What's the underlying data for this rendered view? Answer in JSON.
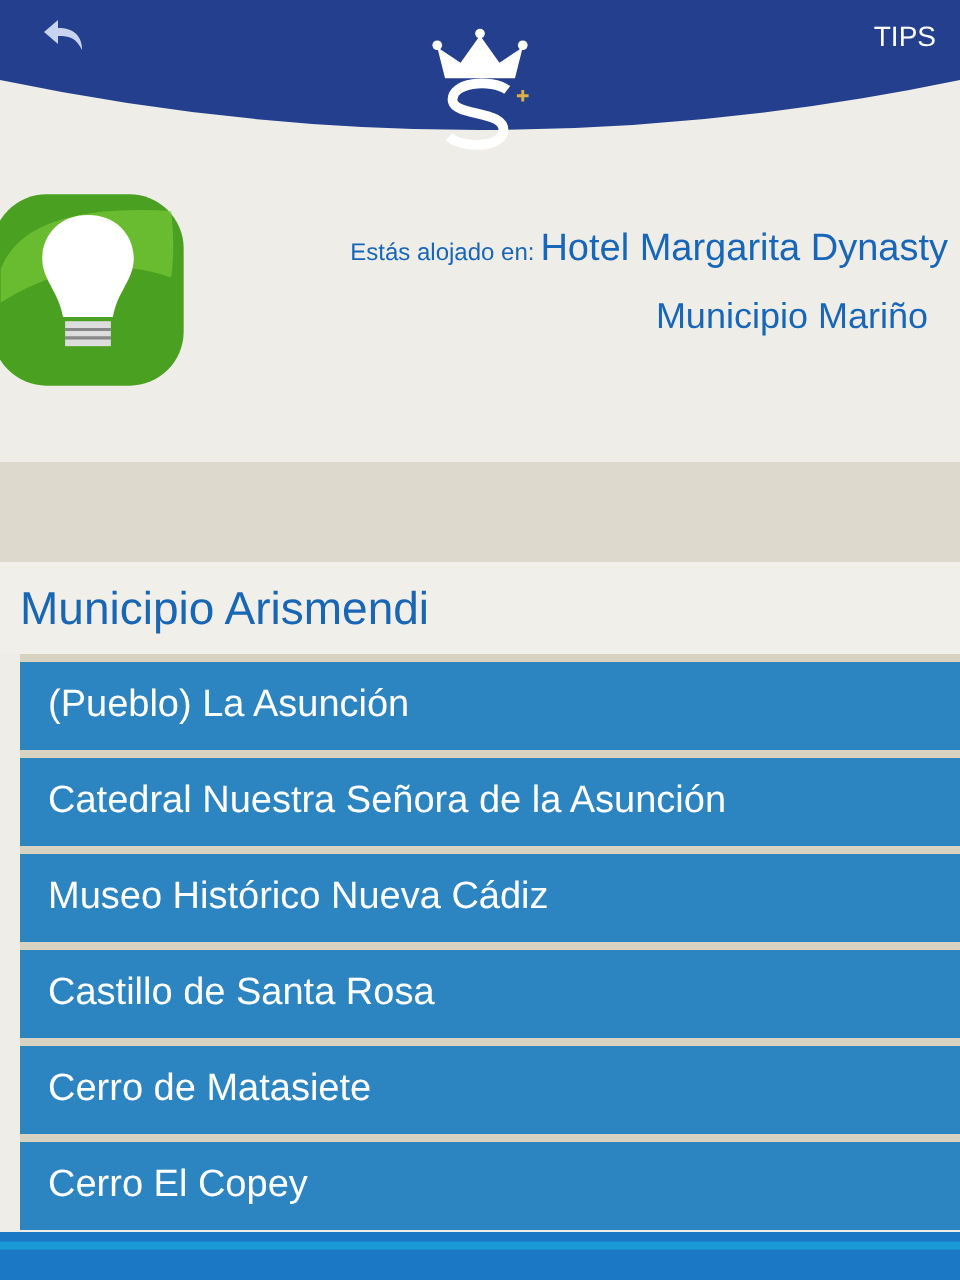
{
  "header": {
    "tips": "TIPS"
  },
  "stay": {
    "label": "Estás alojado en:",
    "hotel": "Hotel Margarita Dynasty",
    "municipality": "Municipio Mariño"
  },
  "section": {
    "title": "Municipio Arismendi"
  },
  "places": [
    {
      "name": "(Pueblo) La Asunción"
    },
    {
      "name": "Catedral Nuestra Señora de la Asunción"
    },
    {
      "name": "Museo Histórico Nueva Cádiz"
    },
    {
      "name": "Castillo de Santa Rosa"
    },
    {
      "name": "Cerro de Matasiete"
    },
    {
      "name": "Cerro El Copey"
    }
  ]
}
